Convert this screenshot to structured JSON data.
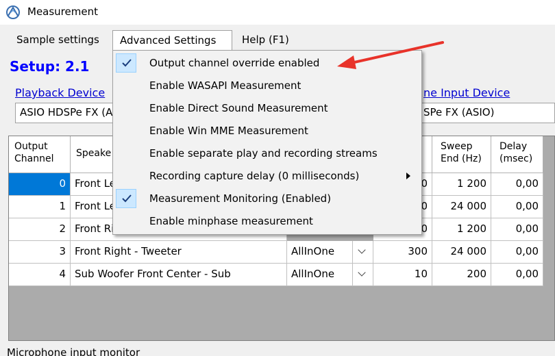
{
  "window": {
    "title": "Measurement"
  },
  "menu": {
    "items": [
      {
        "label": "Sample settings"
      },
      {
        "label": "Advanced Settings"
      },
      {
        "label": "Help (F1)"
      }
    ]
  },
  "setup": {
    "title": "Setup: 2.1"
  },
  "playback": {
    "link": "Playback Device",
    "value": "ASIO HDSPe FX (A"
  },
  "microphone": {
    "link": "ne Input Device",
    "value": "SPe FX (ASIO)"
  },
  "table": {
    "headers": {
      "output_channel": "Output\nChannel",
      "speaker": "Speake",
      "sweep_end": "Sweep\nEnd (Hz)",
      "delay": "Delay\n(msec)"
    },
    "rows": [
      {
        "channel": "0",
        "speaker": "Front Le",
        "method": "",
        "start": "0",
        "end": "1 200",
        "delay": "0,00"
      },
      {
        "channel": "1",
        "speaker": "Front Le",
        "method": "",
        "start": "0",
        "end": "24 000",
        "delay": "0,00"
      },
      {
        "channel": "2",
        "speaker": "Front Ri",
        "method": "",
        "start": "0",
        "end": "1 200",
        "delay": "0,00"
      },
      {
        "channel": "3",
        "speaker": "Front Right - Tweeter",
        "method": "AllInOne",
        "start": "300",
        "end": "24 000",
        "delay": "0,00"
      },
      {
        "channel": "4",
        "speaker": "Sub Woofer Front Center - Sub",
        "method": "AllInOne",
        "start": "10",
        "end": "200",
        "delay": "0,00"
      }
    ]
  },
  "dropdown": {
    "items": [
      {
        "label": "Output channel override enabled",
        "checked": true
      },
      {
        "label": "Enable WASAPI Measurement",
        "checked": false
      },
      {
        "label": "Enable Direct Sound Measurement",
        "checked": false
      },
      {
        "label": "Enable Win MME Measurement",
        "checked": false
      },
      {
        "label": "Enable separate play and recording streams",
        "checked": false
      },
      {
        "label": "Recording capture delay (0 milliseconds)",
        "checked": false,
        "submenu": true
      },
      {
        "label": "Measurement Monitoring (Enabled)",
        "checked": true
      },
      {
        "label": "Enable minphase measurement",
        "checked": false
      }
    ]
  },
  "bottom": {
    "label": "Microphone input monitor"
  },
  "colors": {
    "accent": "#0078d7",
    "setup_title": "#0000ff",
    "link": "#0000d0",
    "annotation": "#e8332a"
  },
  "icons": {
    "app": "measurement-app-icon",
    "check": "checkmark-icon",
    "submenu": "submenu-arrow-icon"
  }
}
